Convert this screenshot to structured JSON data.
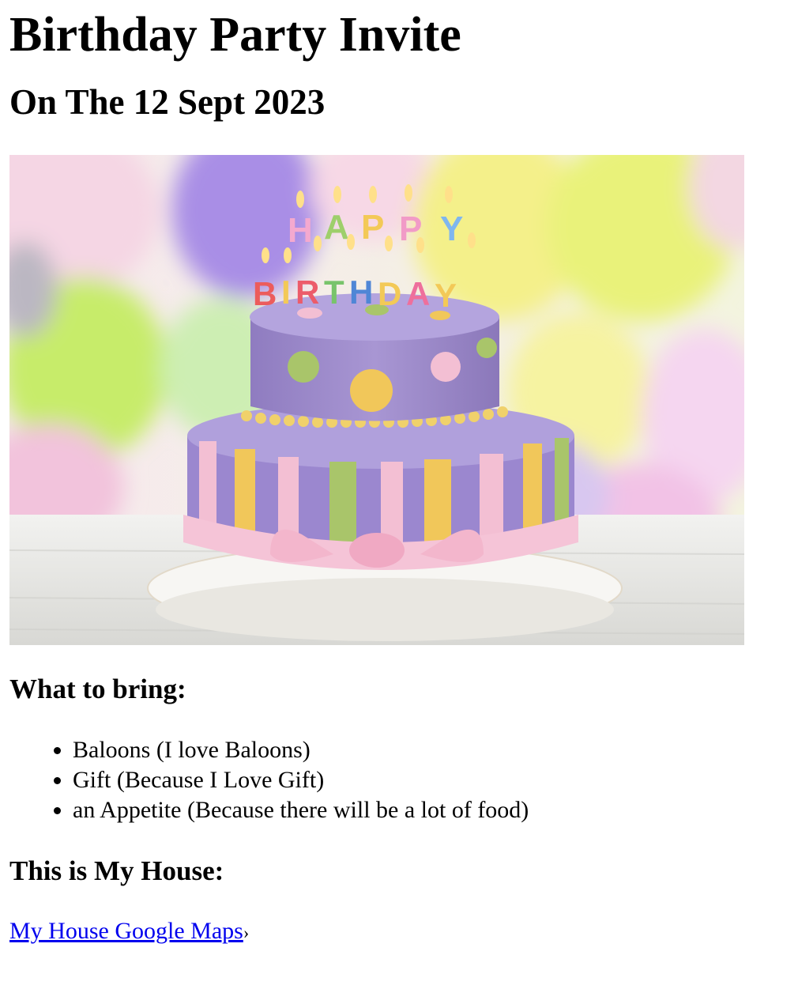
{
  "page": {
    "title": "Birthday Party Invite",
    "date_heading": "On The 12 Sept 2023",
    "image": {
      "alt": "Two-tier purple birthday cake with pastel stripes, dots and HAPPY BIRTHDAY candles in front of colorful balloons",
      "candle_line1": "HAPPY",
      "candle_line2": "BIRTHDAY"
    },
    "bring_heading": "What to bring:",
    "bring_items": [
      "Baloons (I love Baloons)",
      "Gift (Because I Love Gift)",
      "an Appetite (Because there will be a lot of food)"
    ],
    "house_heading": "This is My House:",
    "map_link": {
      "label": "My House Google Maps",
      "suffix": "›"
    }
  },
  "colors": {
    "link": "#0000ee",
    "cake_purple": "#9a86c9",
    "ribbon_pink": "#f3bfd3",
    "stripe_yellow": "#f1c75a",
    "stripe_green": "#a9c56a"
  }
}
